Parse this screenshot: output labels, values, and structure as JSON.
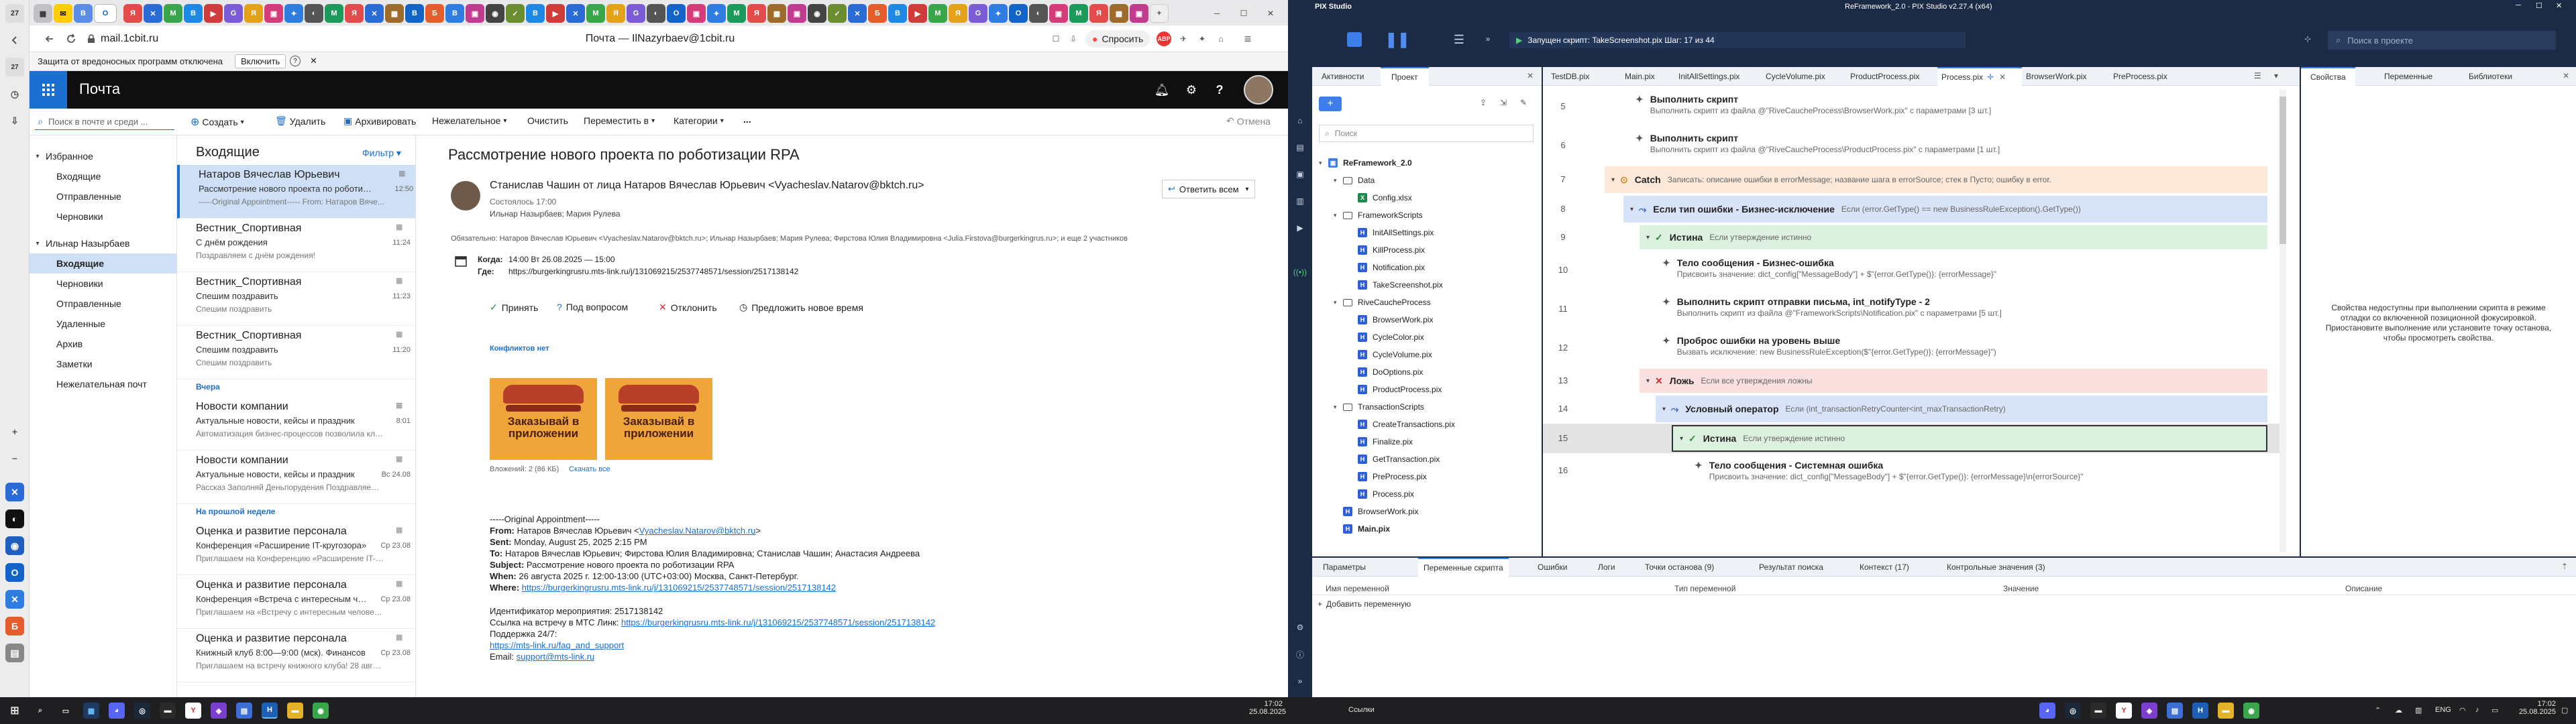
{
  "browser": {
    "address": "mail.1cbit.ru",
    "page_title": "Почта — IlNazyrbaev@1cbit.ru",
    "ask_button": "Спросить",
    "tab_counter": "27",
    "side_counter": "27"
  },
  "protection": {
    "text": "Защита от вредоносных программ отключена",
    "enable": "Включить"
  },
  "mail": {
    "app_name": "Почта",
    "search_placeholder": "Поиск в почте и среди ...",
    "toolbar": {
      "create": "Создать",
      "delete": "Удалить",
      "archive": "Архивировать",
      "junk": "Нежелательное",
      "clear": "Очистить",
      "move": "Переместить в",
      "categories": "Категории",
      "more": "...",
      "undo": "Отмена"
    },
    "folders": [
      {
        "label": "Избранное",
        "kind": "group"
      },
      {
        "label": "Входящие",
        "kind": "item"
      },
      {
        "label": "Отправленные",
        "kind": "item"
      },
      {
        "label": "Черновики",
        "kind": "item"
      },
      {
        "label": "Ильнар Назырбаев",
        "kind": "group"
      },
      {
        "label": "Входящие",
        "kind": "selected"
      },
      {
        "label": "Черновики",
        "kind": "item"
      },
      {
        "label": "Отправленные",
        "kind": "item"
      },
      {
        "label": "Удаленные",
        "kind": "item"
      },
      {
        "label": "Архив",
        "kind": "item"
      },
      {
        "label": "Заметки",
        "kind": "item"
      },
      {
        "label": "Нежелательная почт",
        "kind": "item"
      }
    ],
    "list_title": "Входящие",
    "filter": "Фильтр",
    "messages": [
      {
        "sender": "Натаров Вячеслав Юрьевич",
        "subject": "Рассмотрение нового проекта по роботизаци",
        "preview": "-----Original Appointment----- From: Натаров Вяче...",
        "time": "12:50",
        "selected": true
      },
      {
        "sender": "Вестник_Спортивная",
        "subject": "С днём рождения",
        "preview": "Поздравляем с днём рождения!",
        "time": "11:24",
        "selected": false
      },
      {
        "sender": "Вестник_Спортивная",
        "subject": "Спешим поздравить",
        "preview": "Спешим поздравить",
        "time": "11:23",
        "selected": false
      },
      {
        "sender": "Вестник_Спортивная",
        "subject": "Спешим поздравить",
        "preview": "Спешим поздравить",
        "time": "11:20",
        "selected": false
      },
      {
        "sender": "Новости компании",
        "subject": "Актуальные новости, кейсы и праздник",
        "preview": "Автоматизация бизнес-процессов позволила клие...",
        "time": "8:01",
        "selected": false
      },
      {
        "sender": "Новости компании",
        "subject": "Актуальные новости, кейсы и праздник",
        "preview": "Рассказ Заполняй Деньпорудения Поздравляем Бизнесд...",
        "time": "Вс 24.08",
        "selected": false
      },
      {
        "sender": "Оценка и развитие персонала",
        "subject": "Конференция «Расширение IT-кругозора»",
        "preview": "Приглашаем на Конференцию «Расширение IT-кру...",
        "time": "Ср 23.08",
        "selected": false
      },
      {
        "sender": "Оценка и развитие персонала",
        "subject": "Конференция «Встреча с интересным чело",
        "preview": "Приглашаем на «Встречу с интересным человеком»...",
        "time": "Ср 23.08",
        "selected": false
      },
      {
        "sender": "Оценка и развитие персонала",
        "subject": "Книжный клуб 8:00—9:00 (мск). Финансов",
        "preview": "Приглашаем на встречу книжного клуба! 28 августа",
        "time": "Ср 23.08",
        "selected": false
      }
    ],
    "dividers": {
      "yesterday": "Вчера",
      "last_week": "На прошлой неделе"
    },
    "reading": {
      "title": "Рассмотрение нового проекта по роботизации RPA",
      "from": "Станислав Чашин от лица Натаров Вячеслав Юрьевич <Vyacheslav.Natarov@bktch.ru>",
      "sent": "Состоялось 17:00",
      "recipients": "Ильнар Назырбаев; Мария Рулева",
      "reply_all": "Ответить всем",
      "required": "Обязательно: Натаров Вячеслав Юрьевич <Vyacheslav.Natarov@bktch.ru>; Ильнар Назырбаев; Мария Рулева; Фирстова Юлия Владимировна <Julia.Firstova@burgerkingrus.ru>; и еще 2 участников",
      "when_label": "Когда:",
      "when": "14:00 Вт 26.08.2025 — 15:00",
      "where_label": "Где:",
      "where": "https://burgerkingrusru.mts-link.ru/j/131069215/2537748571/session/2517138142",
      "accept": "Принять",
      "tentative": "Под вопросом",
      "decline": "Отклонить",
      "propose": "Предложить новое время",
      "conflicts": "Конфликтов нет",
      "img_text": "Заказывай в приложении",
      "attach_info": "Вложений: 2 (86 КБ)",
      "download": "Скачать все",
      "orig": "-----Original Appointment-----",
      "from_l": "From:",
      "from_v": "Натаров Вячеслав Юрьевич <",
      "from_mail": "Vyacheslav.Natarov@bktch.ru",
      "from_end": ">",
      "sent_l": "Sent:",
      "sent_v": "Monday, August 25, 2025 2:15 PM",
      "to_l": "To:",
      "to_v": "Натаров Вячеслав Юрьевич; Фирстова Юлия Владимировна; Станислав Чашин; Анастасия Андреева",
      "subj_l": "Subject:",
      "subj_v": "Рассмотрение нового проекта по роботизации RPA",
      "when2_l": "When:",
      "when2_v": "26 августа 2025 г. 12:00-13:00 (UTC+03:00) Москва, Санкт-Петербург.",
      "where2_l": "Where:",
      "where2_v": "https://burgerkingrusru.mts-link.ru/j/131069215/2537748571/session/2517138142",
      "ev_id": "Идентификатор мероприятия: 2517138142",
      "link_l": "Ссылка на встречу в МТС Линк:",
      "link_v": "https://burgerkingrusru.mts-link.ru/j/131069215/2537748571/session/2517138142",
      "support": "Поддержка 24/7:",
      "support_link": "https://mts-link.ru/faq_and_support",
      "email_l": "Email:",
      "email_v": "support@mts-link.ru"
    }
  },
  "pix": {
    "window_title": "ReFramework_2.0 - PIX Studio v2.27.4 (x64)",
    "app_name": "PIX Studio",
    "running": "Запущен скрипт: TakeScreenshot.pix   Шаг: 17 из 44",
    "search_project": "Поиск в проекте",
    "left_tabs": [
      "Активности",
      "Проект"
    ],
    "editor_tabs": [
      "TestDB.pix",
      "Main.pix",
      "InitAllSettings.pix",
      "CycleVolume.pix",
      "ProductProcess.pix",
      "Process.pix",
      "BrowserWork.pix",
      "PreProcess.pix"
    ],
    "active_editor_tab": "Process.pix",
    "right_tabs": [
      "Свойства",
      "Переменные",
      "Библиотеки"
    ],
    "search": "Поиск",
    "tree": [
      {
        "label": "ReFramework_2.0",
        "level": 0,
        "kind": "root"
      },
      {
        "label": "Data",
        "level": 1,
        "kind": "folder"
      },
      {
        "label": "Config.xlsx",
        "level": 2,
        "kind": "excel"
      },
      {
        "label": "FrameworkScripts",
        "level": 1,
        "kind": "folder"
      },
      {
        "label": "InitAllSettings.pix",
        "level": 2,
        "kind": "pix"
      },
      {
        "label": "KillProcess.pix",
        "level": 2,
        "kind": "pix"
      },
      {
        "label": "Notification.pix",
        "level": 2,
        "kind": "pix"
      },
      {
        "label": "TakeScreenshot.pix",
        "level": 2,
        "kind": "pix"
      },
      {
        "label": "RiveCaucheProcess",
        "level": 1,
        "kind": "folder"
      },
      {
        "label": "BrowserWork.pix",
        "level": 2,
        "kind": "pix"
      },
      {
        "label": "CycleColor.pix",
        "level": 2,
        "kind": "pix"
      },
      {
        "label": "CycleVolume.pix",
        "level": 2,
        "kind": "pix"
      },
      {
        "label": "DoOptions.pix",
        "level": 2,
        "kind": "pix"
      },
      {
        "label": "ProductProcess.pix",
        "level": 2,
        "kind": "pix"
      },
      {
        "label": "TransactionScripts",
        "level": 1,
        "kind": "folder"
      },
      {
        "label": "CreateTransactions.pix",
        "level": 2,
        "kind": "pix"
      },
      {
        "label": "Finalize.pix",
        "level": 2,
        "kind": "pix"
      },
      {
        "label": "GetTransaction.pix",
        "level": 2,
        "kind": "pix"
      },
      {
        "label": "PreProcess.pix",
        "level": 2,
        "kind": "pix"
      },
      {
        "label": "Process.pix",
        "level": 2,
        "kind": "pix"
      },
      {
        "label": "BrowserWork.pix",
        "level": 1,
        "kind": "pix"
      },
      {
        "label": "Main.pix",
        "level": 1,
        "kind": "pixb"
      }
    ],
    "workflow": [
      {
        "line": "5",
        "title": "Выполнить скрипт",
        "sub": "Выполнить скрипт из файла @\"RiveCaucheProcess\\BrowserWork.pix\" с параметрами [3 шт.]",
        "kind": "act"
      },
      {
        "line": "6",
        "title": "Выполнить скрипт",
        "sub": "Выполнить скрипт из файла @\"RiveCaucheProcess\\ProductProcess.pix\" с параметрами [1 шт.]",
        "kind": "act"
      },
      {
        "line": "7",
        "title": "Catch",
        "sub": "Записать: описание ошибки в errorMessage; название шага в errorSource; стек в Пусто; ошибку в error.",
        "kind": "catch"
      },
      {
        "line": "8",
        "title": "Если тип ошибки - Бизнес-исключение",
        "sub": "Если (error.GetType() == new BusinessRuleException().GetType())",
        "kind": "if"
      },
      {
        "line": "9",
        "title": "Истина",
        "sub": "Если утверждение истинно",
        "kind": "true"
      },
      {
        "line": "10",
        "title": "Тело сообщения - Бизнес-ошибка",
        "sub": "Присвоить значение: dict_config[\"MessageBody\"] + $\"{error.GetType()}: {errorMessage}\"",
        "kind": "act"
      },
      {
        "line": "11",
        "title": "Выполнить скрипт отправки письма, int_notifyType - 2",
        "sub": "Выполнить скрипт из файла @\"FrameworkScripts\\Notification.pix\" с параметрами [5 шт.]",
        "kind": "act"
      },
      {
        "line": "12",
        "title": "Проброс ошибки на уровень выше",
        "sub": "Вызвать исключение: new BusinessRuleException($\"{error.GetType()}: {errorMessage}\")",
        "kind": "act"
      },
      {
        "line": "13",
        "title": "Ложь",
        "sub": "Если все утверждения ложны",
        "kind": "false"
      },
      {
        "line": "14",
        "title": "Условный оператор",
        "sub": "Если (int_transactionRetryCounter<int_maxTransactionRetry)",
        "kind": "if"
      },
      {
        "line": "15",
        "title": "Истина",
        "sub": "Если утверждение истинно",
        "kind": "true-sel"
      },
      {
        "line": "16",
        "title": "Тело сообщения - Системная ошибка",
        "sub": "Присвоить значение: dict_config[\"MessageBody\"] + $\"{error.GetType()}: {errorMessage}\\n{errorSource}\"",
        "kind": "act"
      }
    ],
    "props_message": "Свойства недоступны при выполнении скрипта в режиме отладки со включенной позиционной фокусировкой. Приостановите выполнение или установите точку останова, чтобы просмотреть свойства.",
    "bottom_tabs": [
      "Параметры",
      "Переменные скрипта",
      "Ошибки",
      "Логи",
      "Точки останова (9)",
      "Результат поиска",
      "Контекст (17)",
      "Контрольные значения (3)"
    ],
    "active_bottom_tab": "Переменные скрипта",
    "var_columns": [
      "Имя переменной",
      "Тип переменной",
      "Значение",
      "Описание"
    ],
    "add_variable": "Добавить переменную"
  },
  "taskbar": {
    "left_time": "17:02",
    "left_date": "25.08.2025",
    "right_time": "17:02",
    "right_date": "25.08.2025",
    "lang": "ENG",
    "links": "Ссылки"
  }
}
